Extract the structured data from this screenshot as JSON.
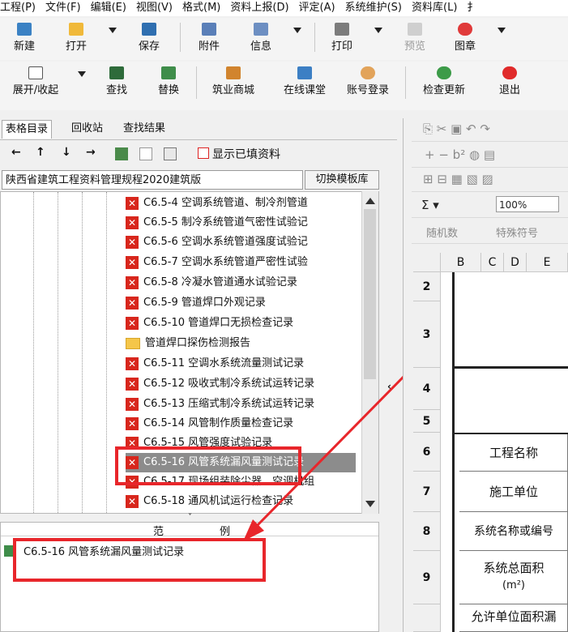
{
  "menu": [
    "工程(P)",
    "文件(F)",
    "编辑(E)",
    "视图(V)",
    "格式(M)",
    "资料上报(D)",
    "评定(A)",
    "系统维护(S)",
    "资料库(L)",
    "扌"
  ],
  "toolbar1": {
    "new": "新建",
    "open": "打开",
    "save": "保存",
    "attach": "附件",
    "info": "信息",
    "print": "打印",
    "preview": "预览",
    "stamp": "图章"
  },
  "toolbar2": {
    "expand": "展开/收起",
    "find": "查找",
    "replace": "替换",
    "mall": "筑业商城",
    "course": "在线课堂",
    "login": "账号登录",
    "update": "检查更新",
    "exit": "退出"
  },
  "tabs": [
    "表格目录",
    "回收站",
    "查找结果"
  ],
  "nav": {
    "show_filled": "显示已填资料"
  },
  "template": {
    "name": "陕西省建筑工程资料管理规程2020建筑版",
    "switch": "切换模板库"
  },
  "tree": [
    {
      "code": "C6.5-4",
      "title": "空调系统管道、制冷剂管道"
    },
    {
      "code": "C6.5-5",
      "title": "制冷系统管道气密性试验记"
    },
    {
      "code": "C6.5-6",
      "title": "空调水系统管道强度试验记"
    },
    {
      "code": "C6.5-7",
      "title": "空调水系统管道严密性试验"
    },
    {
      "code": "C6.5-8",
      "title": "冷凝水管道通水试验记录"
    },
    {
      "code": "C6.5-9",
      "title": "管道焊口外观记录"
    },
    {
      "code": "C6.5-10",
      "title": "管道焊口无损检查记录"
    },
    {
      "code": "",
      "title": "管道焊口探伤检测报告"
    },
    {
      "code": "C6.5-11",
      "title": "空调水系统流量测试记录"
    },
    {
      "code": "C6.5-12",
      "title": "吸收式制冷系统试运转记录"
    },
    {
      "code": "C6.5-13",
      "title": "压缩式制冷系统试运转记录"
    },
    {
      "code": "C6.5-14",
      "title": "风管制作质量检查记录"
    },
    {
      "code": "C6.5-15",
      "title": "风管强度试验记录"
    },
    {
      "code": "C6.5-16",
      "title": "风管系统漏风量测试记录"
    },
    {
      "code": "C6.5-17",
      "title": "现场组装除尘器、空调机组"
    },
    {
      "code": "C6.5-18",
      "title": "通风机试运行检查记录"
    }
  ],
  "sample": {
    "header_left": "范",
    "header_right": "例",
    "item": "C6.5-16 风管系统漏风量测试记录"
  },
  "right_toolbar": {
    "zoom": "100%",
    "random": "随机数",
    "special": "特殊符号"
  },
  "grid": {
    "columns": [
      "B",
      "C",
      "D",
      "E"
    ],
    "rows": [
      "2",
      "3",
      "4",
      "5",
      "6",
      "7",
      "8",
      "9"
    ],
    "labels": {
      "r6": "工程名称",
      "r7": "施工单位",
      "r8": "系统名称或编号",
      "r9a": "系统总面积",
      "r9b": "(m²)",
      "r10": "允许单位面积漏"
    }
  },
  "colors": {
    "accent_red": "#e8262b",
    "selected": "#8c8c8c"
  }
}
